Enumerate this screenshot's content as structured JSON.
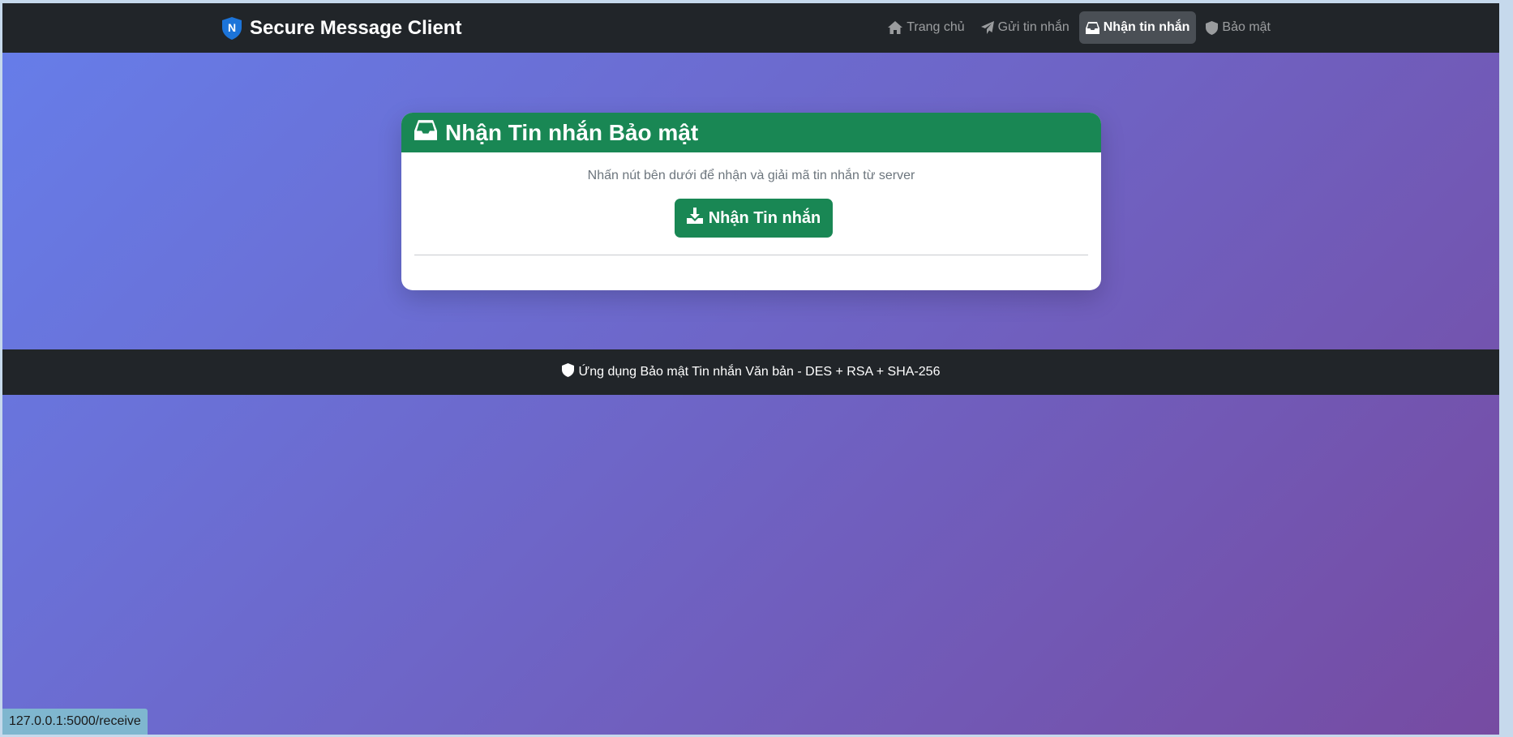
{
  "navbar": {
    "brand_icon_letter": "N",
    "brand_title": "Secure Message Client",
    "links": [
      {
        "label": "Trang chủ",
        "icon": "home-icon",
        "active": false
      },
      {
        "label": "Gửi tin nhắn",
        "icon": "paper-plane-icon",
        "active": false
      },
      {
        "label": "Nhận tin nhắn",
        "icon": "inbox-icon",
        "active": true
      },
      {
        "label": "Bảo mật",
        "icon": "shield-icon",
        "active": false
      }
    ]
  },
  "card": {
    "title": "Nhận Tin nhắn Bảo mật",
    "title_icon": "inbox-icon",
    "description": "Nhấn nút bên dưới để nhận và giải mã tin nhắn từ server",
    "button_label": "Nhận Tin nhắn",
    "button_icon": "download-icon"
  },
  "footer": {
    "text": "Ứng dụng Bảo mật Tin nhắn Văn bản - DES + RSA + SHA-256",
    "icon": "shield-icon"
  },
  "status_bar": {
    "url": "127.0.0.1:5000/receive"
  },
  "colors": {
    "gradient_start": "#667eea",
    "gradient_end": "#764ba2",
    "navbar_bg": "#212529",
    "success": "#198754"
  }
}
